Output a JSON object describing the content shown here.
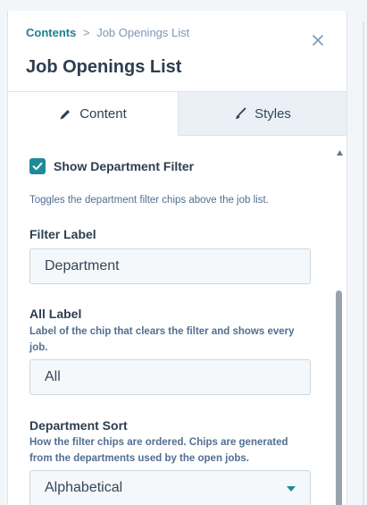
{
  "breadcrumb": {
    "parent": "Contents",
    "separator": ">",
    "current": "Job Openings List"
  },
  "header": {
    "title": "Job Openings List",
    "close_icon": "close-icon"
  },
  "tabs": [
    {
      "label": "Content",
      "icon": "pencil-icon",
      "active": true
    },
    {
      "label": "Styles",
      "icon": "brush-icon",
      "active": false
    }
  ],
  "fields": {
    "show_department_filter": {
      "label": "Show Department Filter",
      "checked": true,
      "help": "Toggles the department filter chips above the job list."
    },
    "filter_label": {
      "label": "Filter Label",
      "value": "Department"
    },
    "all_label": {
      "label": "All Label",
      "help": "Label of the chip that clears the filter and shows every job.",
      "value": "All"
    },
    "department_sort": {
      "label": "Department Sort",
      "help": "How the filter chips are ordered. Chips are generated from the departments used by the open jobs.",
      "value": "Alphabetical"
    }
  },
  "colors": {
    "accent": "#1f8a98",
    "link": "#1f7f8f",
    "text": "#33475b"
  }
}
